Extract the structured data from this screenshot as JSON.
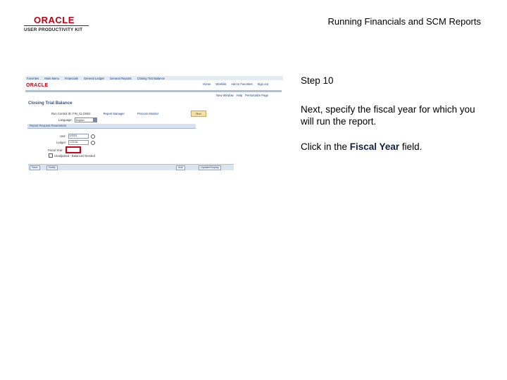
{
  "header": {
    "logo_brand": "ORACLE",
    "logo_product": "USER PRODUCTIVITY KIT",
    "document_title": "Running Financials and SCM Reports"
  },
  "step": {
    "title": "Step 10",
    "body": "Next, specify the fiscal year for which you will run the report.",
    "action_prefix": "Click in the ",
    "action_target": "Fiscal Year",
    "action_suffix": " field."
  },
  "screenshot": {
    "menu_items": [
      "Favorites",
      "Main Menu",
      "Financials",
      "General Ledger",
      "General Reports",
      "Closing Trial Balance"
    ],
    "brand": "ORACLE",
    "top_links": [
      "Home",
      "Worklist",
      "Add to Favorites",
      "Sign out"
    ],
    "page_links": [
      "New Window",
      "Help",
      "Personalize Page"
    ],
    "page_heading": "Closing Trial Balance",
    "run_control_label": "Run Control ID:",
    "run_control_value": "FIN_CLOSE2",
    "report_manager_link": "Report Manager",
    "process_monitor_link": "Process Monitor",
    "run_button": "Run",
    "language_label": "Language:",
    "language_value": "English",
    "section_label": "Report Request Parameters",
    "unit_label": "Unit:",
    "unit_value": "US001",
    "ledger_label": "Ledger:",
    "ledger_value": "LOCAL",
    "fiscal_year_label": "Fiscal Year:",
    "checkbox_label": "Unadjusted - Balances Needed",
    "footer_save": "Save",
    "footer_notify": "Notify",
    "footer_add": "Add",
    "footer_update": "Update/Display"
  },
  "colors": {
    "oracle_red": "#c3000f",
    "highlight_red": "#d10016",
    "link_blue": "#1a3d7c"
  }
}
